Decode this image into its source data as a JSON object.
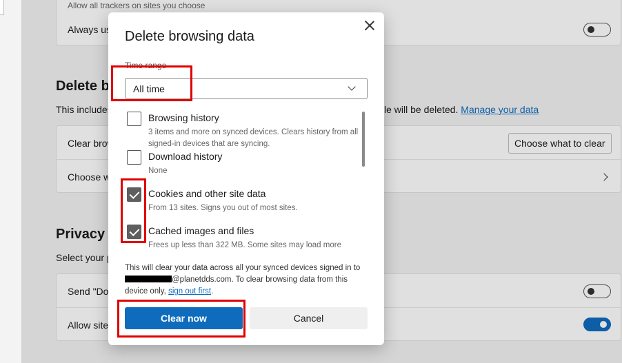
{
  "background": {
    "trackers_desc": "Allow all trackers on sites you choose",
    "always_use_label": "Always us",
    "delete_section_title": "Delete b",
    "delete_desc_start": "This includes",
    "delete_desc_end": "le will be deleted.",
    "manage_link": "Manage your data",
    "clear_row_label": "Clear brow",
    "choose_btn_label": "Choose what to clear",
    "choose_row_label": "Choose w",
    "privacy_title": "Privacy",
    "privacy_desc": "Select your p",
    "send_row_label": "Send \"Do",
    "allow_row_label": "Allow site"
  },
  "dialog": {
    "title": "Delete browsing data",
    "time_range_label": "Time range",
    "time_range_value": "All time",
    "items": [
      {
        "label": "Browsing history",
        "desc": "3 items and more on synced devices. Clears history from all signed-in devices that are syncing.",
        "checked": false
      },
      {
        "label": "Download history",
        "desc": "None",
        "checked": false
      },
      {
        "label": "Cookies and other site data",
        "desc": "From 13 sites. Signs you out of most sites.",
        "checked": true
      },
      {
        "label": "Cached images and files",
        "desc": "Frees up less than 322 MB. Some sites may load more",
        "checked": true
      }
    ],
    "note_start": "This will clear your data across all your synced devices signed in to ",
    "note_email_suffix": "@planetdds.com. To clear browsing data from this device only, ",
    "note_link": "sign out first",
    "note_end": ".",
    "clear_now": "Clear now",
    "cancel": "Cancel"
  },
  "colors": {
    "accent": "#0f6cbd",
    "highlight": "#e00000"
  }
}
